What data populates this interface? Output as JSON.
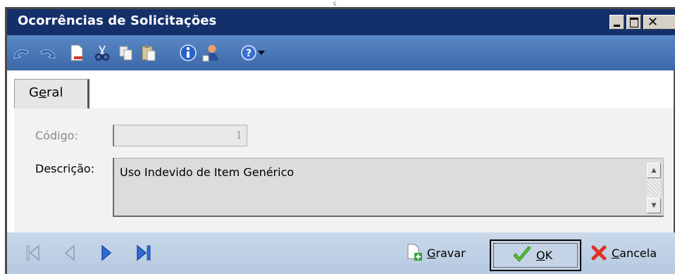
{
  "window": {
    "title": "Ocorrências de Solicitações",
    "stray_mark": "ç"
  },
  "toolbar": {
    "icons": [
      "undo-icon",
      "redo-icon",
      "new-document-icon",
      "cut-icon",
      "copy-icon",
      "paste-icon",
      "info-icon",
      "user-icon",
      "help-icon",
      "dropdown-arrow-icon"
    ]
  },
  "tabs": [
    {
      "label": "Geral",
      "active": true
    }
  ],
  "form": {
    "code_label": "Código:",
    "code_value": "1",
    "description_label": "Descrição:",
    "description_value": "Uso Indevido de Item Genérico"
  },
  "footer": {
    "save_label": "Gravar",
    "ok_label": "OK",
    "cancel_label": "Cancela"
  }
}
